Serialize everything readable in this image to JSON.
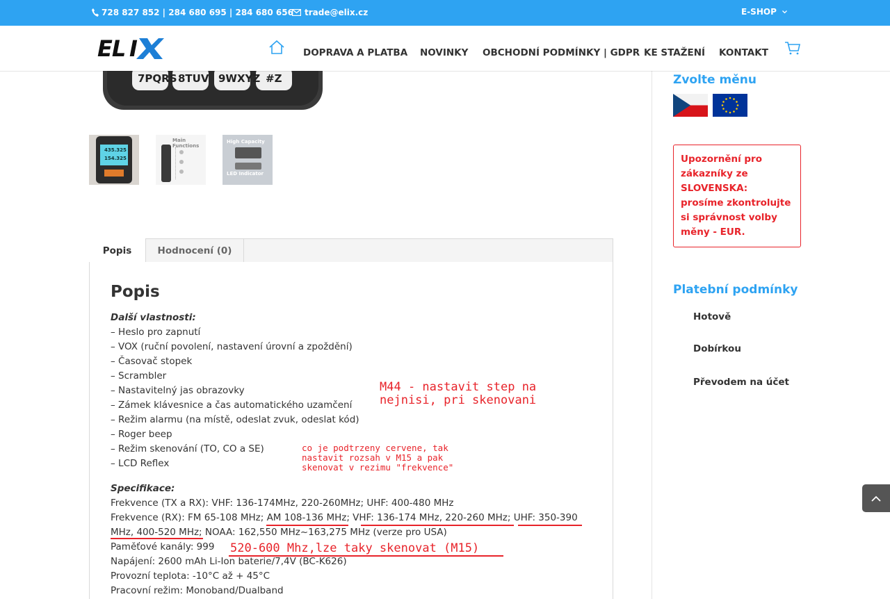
{
  "topbar": {
    "phones": "728 827 852 | 284 680 695 | 284 680 656",
    "email": "trade@elix.cz",
    "eshop": "E-SHOP"
  },
  "header": {
    "logo_text": "ELIX",
    "nav": [
      "DOPRAVA A PLATBA",
      "NOVINKY",
      "OBCHODNÍ PODMÍNKY | GDPR",
      "KE STAŽENÍ",
      "KONTAKT"
    ]
  },
  "product": {
    "keypad_labels": [
      "7PQRS",
      "8TUV",
      "9WXYZ",
      "#Z"
    ],
    "thumbs": [
      {
        "lines": [
          "435.325",
          "154.325"
        ]
      },
      {
        "lines": [
          "Main Functions"
        ]
      },
      {
        "lines": [
          "High Capacity",
          "LED Indicator"
        ]
      }
    ]
  },
  "tabs": [
    "Popis",
    "Hodnocení (0)"
  ],
  "description": {
    "heading": "Popis",
    "features_title": "Další vlastnosti:",
    "features": [
      "– Heslo pro zapnutí",
      "– VOX (ruční povolení, nastavení úrovní a zpoždění)",
      "– Časovač stopek",
      "– Scrambler",
      "– Nastavitelný jas obrazovky",
      "– Zámek klávesnice a čas automatického uzamčení",
      "– Režim alarmu (na místě, odeslat zvuk, odeslat kód)",
      "– Roger beep",
      "– Režim skenování (TO, CO a SE)",
      "– LCD Reflex"
    ],
    "specs_title": "Specifikace:",
    "specs": [
      "Frekvence (TX a RX): VHF: 136-174MHz, 220-260MHz; UHF: 400-480 MHz",
      "Frekvence (RX): FM 65-108 MHz; AM 108-136 MHz; VHF: 136-174 MHz, 220-260 MHz; UHF: 350-390",
      "MHz, 400-520 MHz; NOAA: 162,550 MHz~163,275 MHz (verze pro USA)",
      "Paměťové kanály: 999",
      "Napájení: 2600 mAh Li-Ion baterie/7,4V (BC-K626)",
      "Provozní teplota: -10°C až + 45°C",
      "Pracovní režim: Monoband/Dualband"
    ],
    "annotations": [
      "M44 - nastavit step na",
      "nejnisi, pri skenovani",
      "co je podtrzeny cervene, tak",
      "nastavit rozsah v M15 a pak",
      "skenovat v rezimu \"frekvence\"",
      "520-600 Mhz,lze taky skenovat (M15)"
    ]
  },
  "sidebar": {
    "currency_title": "Zvolte měnu",
    "warning": "Upozornění pro zákazníky ze SLOVENSKA: prosíme zkontrolujte si správnost volby měny - EUR.",
    "payment_title": "Platební podmínky",
    "payments": [
      "Hotově",
      "Dobírkou",
      "Převodem na účet"
    ]
  },
  "colors": {
    "accent": "#2ea3f2",
    "annotation": "#e8232a"
  }
}
